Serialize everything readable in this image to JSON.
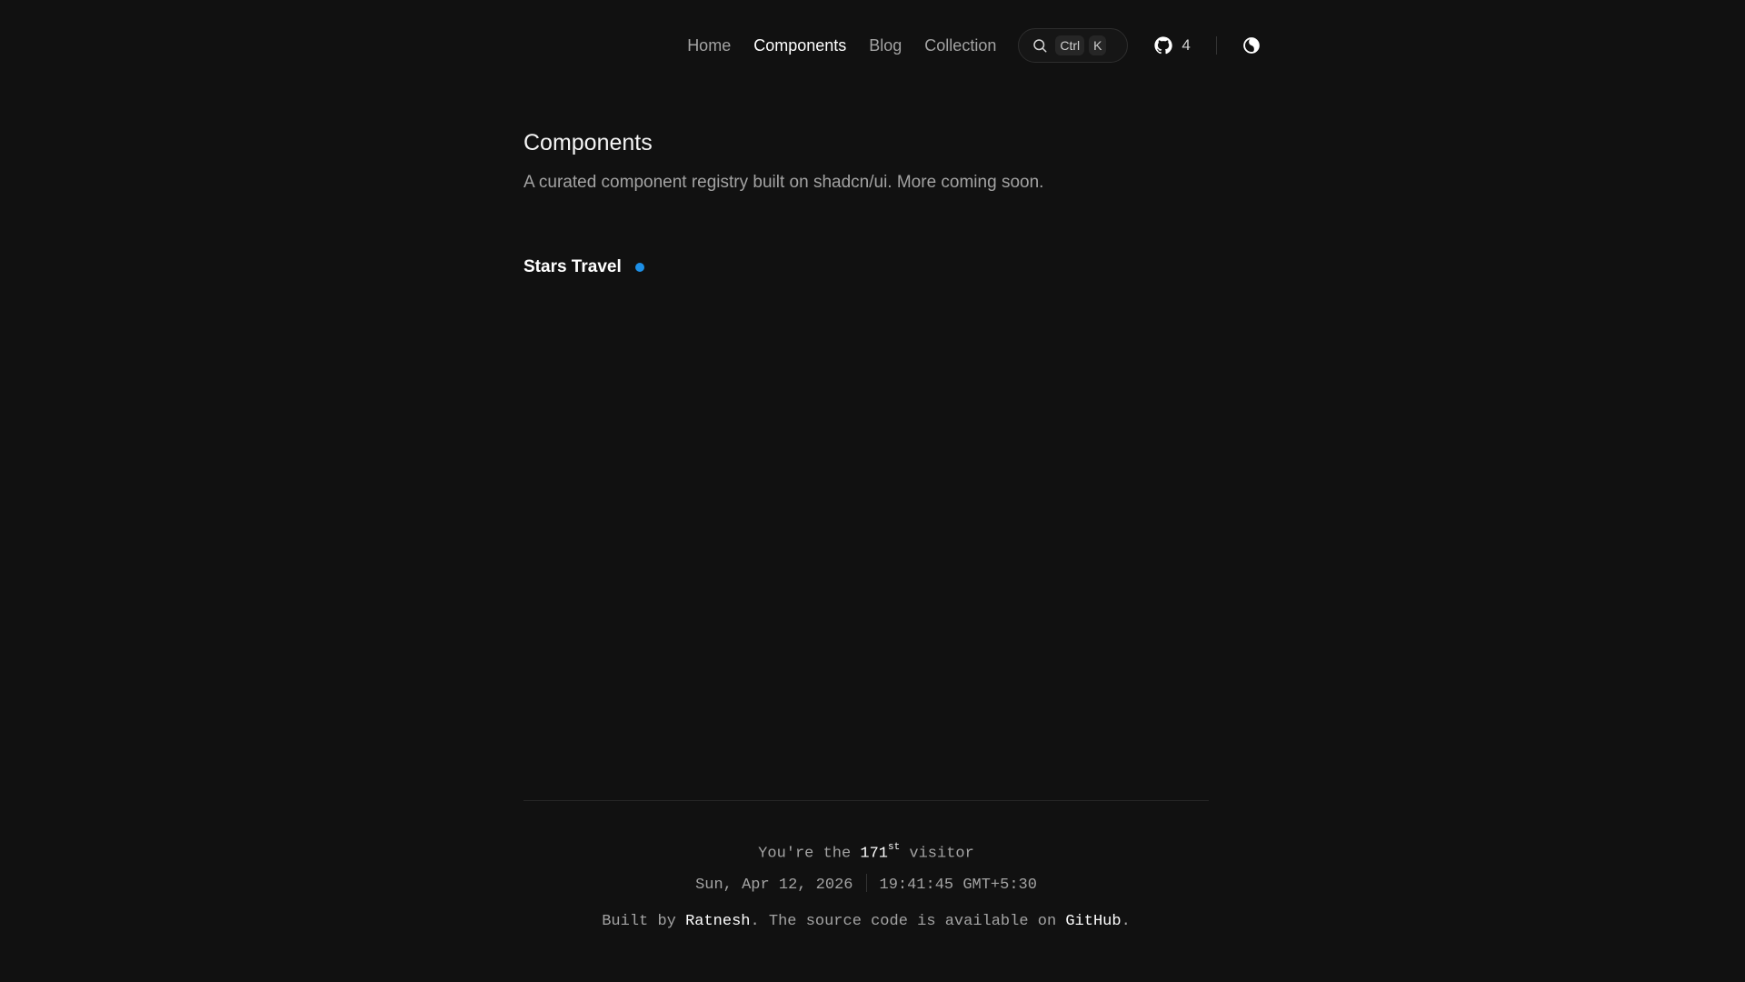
{
  "nav": {
    "links": [
      {
        "label": "Home",
        "active": false
      },
      {
        "label": "Components",
        "active": true
      },
      {
        "label": "Blog",
        "active": false
      },
      {
        "label": "Collection",
        "active": false
      }
    ],
    "search": {
      "icon": "search-icon",
      "kbd_ctrl": "Ctrl",
      "kbd_k": "K"
    },
    "github": {
      "icon": "github-icon",
      "count": "4"
    },
    "theme_toggle": {
      "icon": "theme-toggle-icon"
    }
  },
  "main": {
    "title": "Components",
    "description": "A curated component registry built on shadcn/ui. More coming soon.",
    "components": [
      {
        "name": "Stars Travel",
        "status_color": "#1d8fe6"
      }
    ]
  },
  "footer": {
    "visitor_prefix": "You're the ",
    "visitor_count": "171",
    "visitor_suffix_sup": "st",
    "visitor_suffix": " visitor",
    "date": "Sun, Apr 12, 2026",
    "time": "19:41:45 GMT+5:30",
    "built_prefix": "Built by ",
    "author": "Ratnesh",
    "built_middle": ". The source code is available on ",
    "repo": "GitHub",
    "built_suffix": "."
  },
  "colors": {
    "background": "#111111",
    "accent": "#1d8fe6"
  }
}
